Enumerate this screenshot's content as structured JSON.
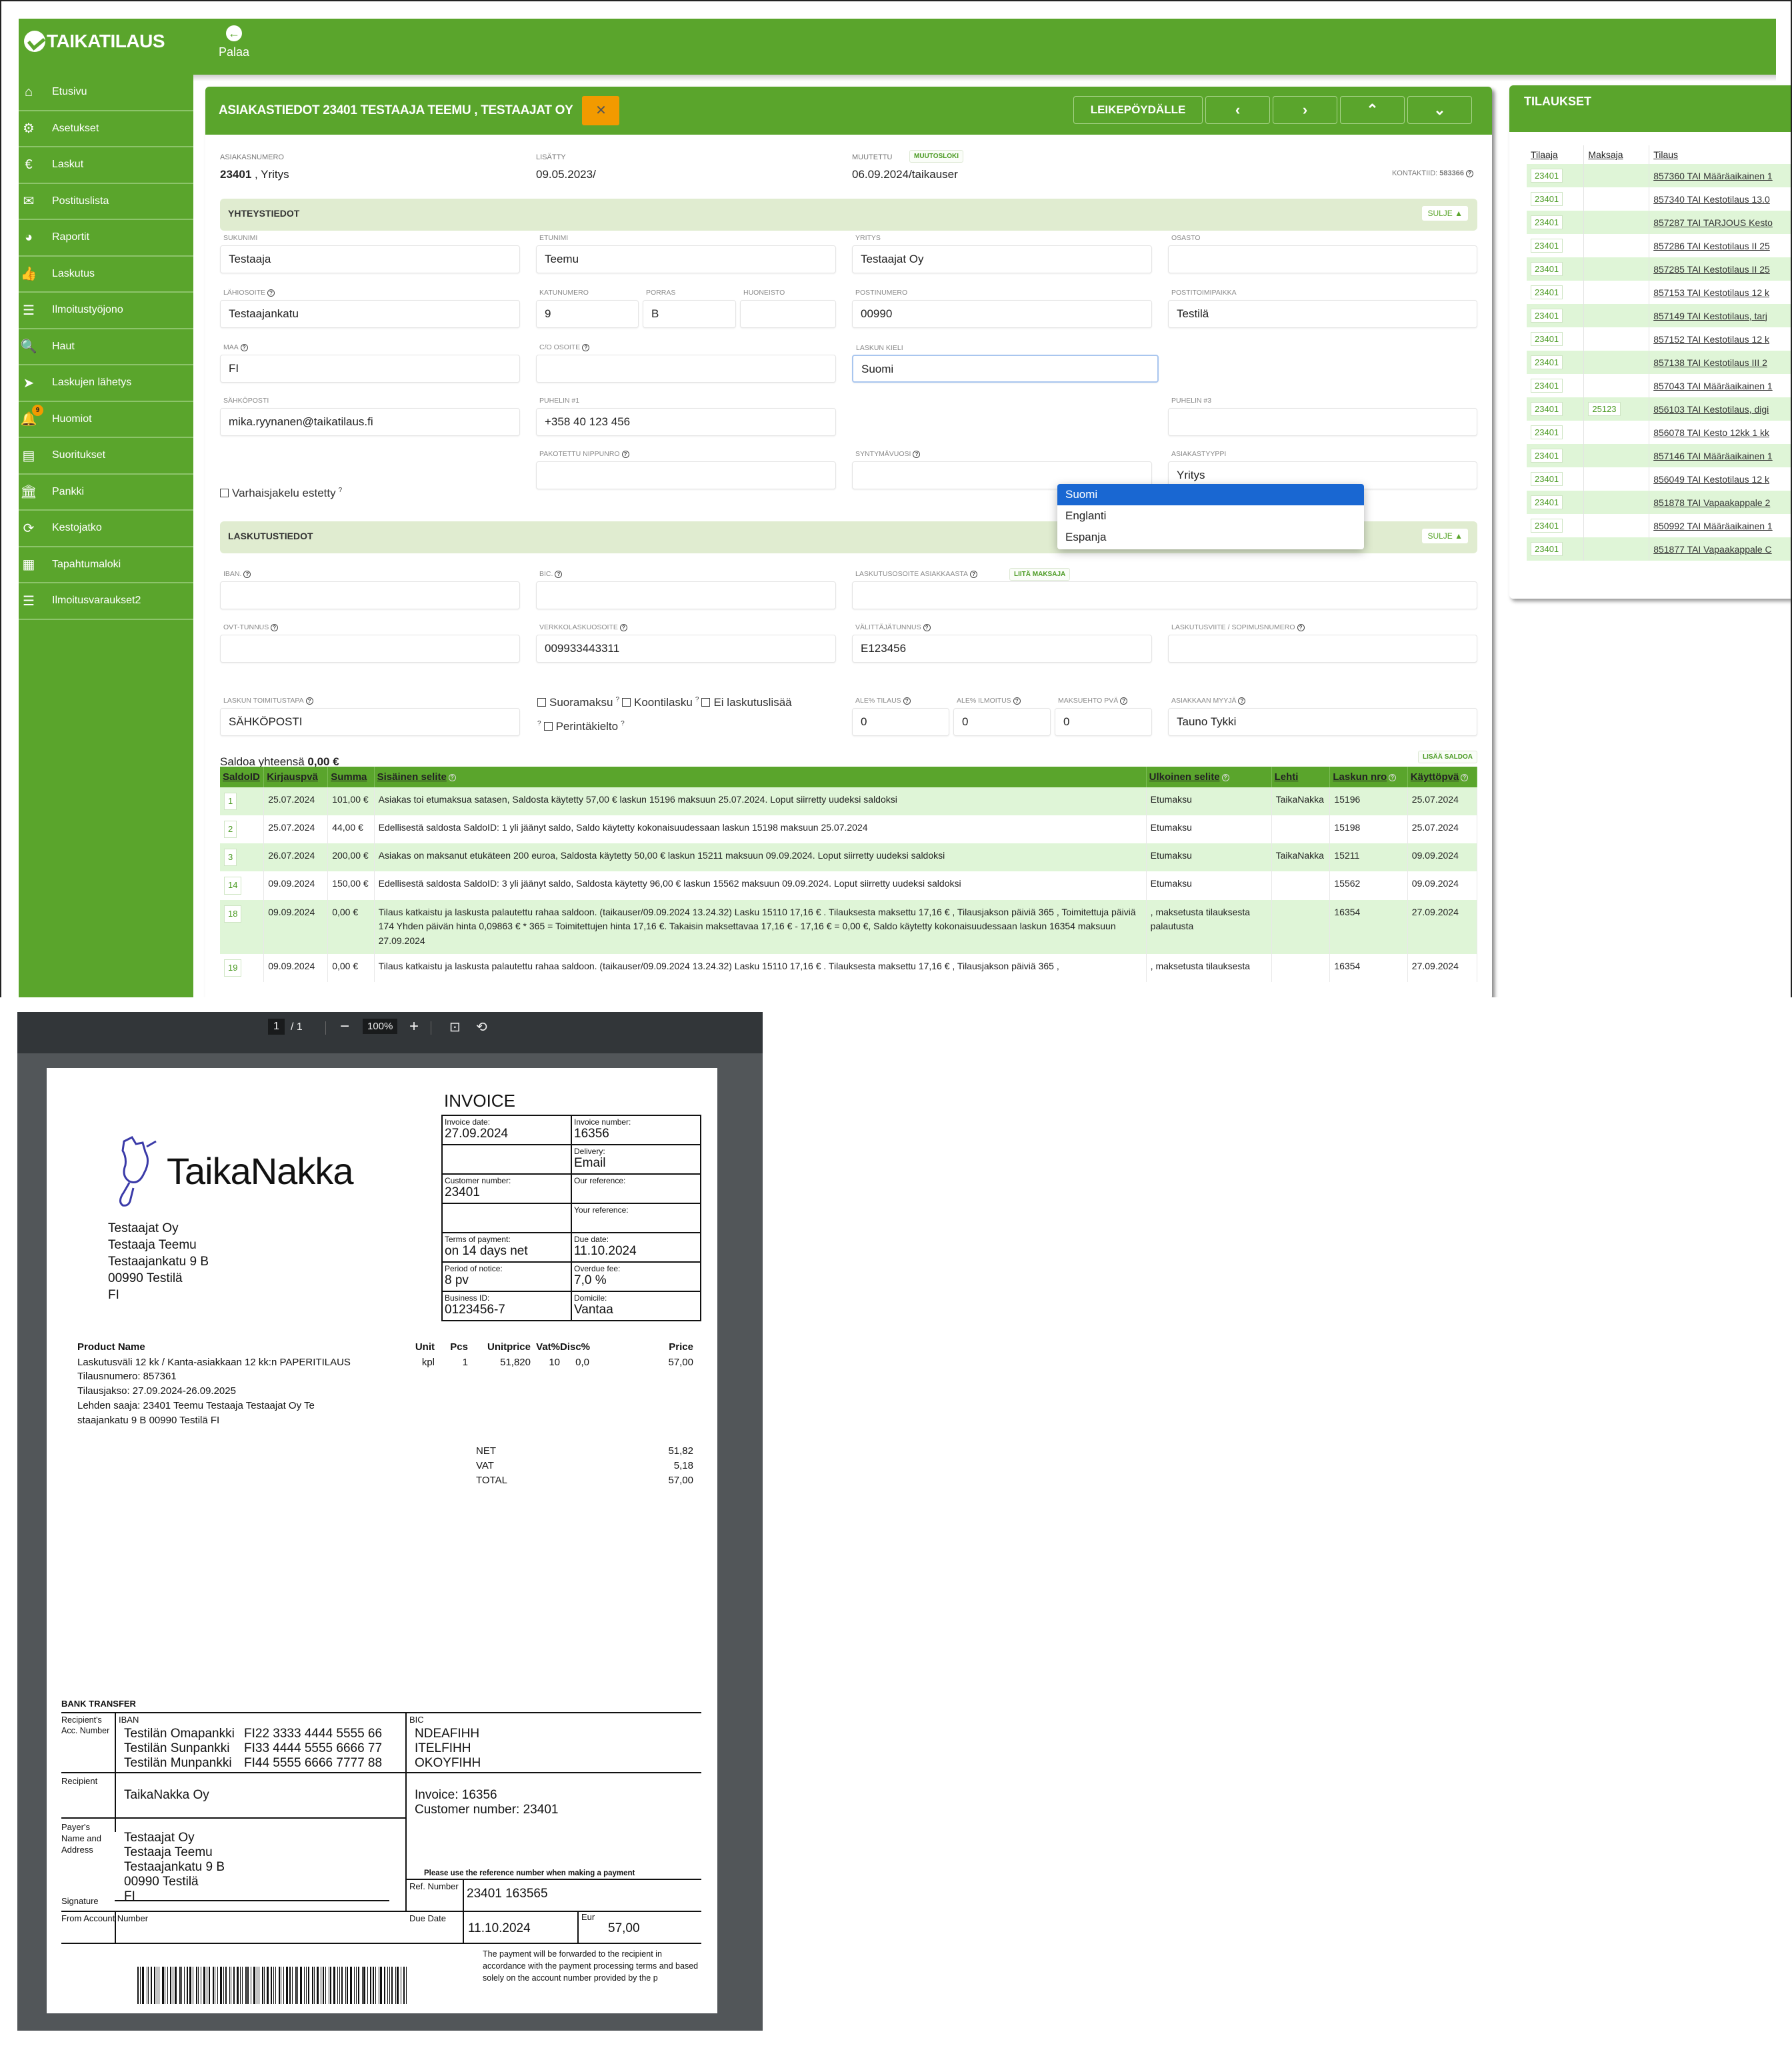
{
  "app": {
    "logo_text": "TAIKATILAUS",
    "back_label": "Palaa",
    "sidebar": [
      {
        "label": "Etusivu",
        "icon": "home-icon",
        "glyph": "⌂"
      },
      {
        "label": "Asetukset",
        "icon": "gear-icon",
        "glyph": "⚙"
      },
      {
        "label": "Laskut",
        "icon": "euro-icon",
        "glyph": "€"
      },
      {
        "label": "Postituslista",
        "icon": "envelope-icon",
        "glyph": "✉"
      },
      {
        "label": "Raportit",
        "icon": "pie-chart-icon",
        "glyph": "◕"
      },
      {
        "label": "Laskutus",
        "icon": "thumbs-up-icon",
        "glyph": "👍"
      },
      {
        "label": "Ilmoitustyöjono",
        "icon": "list-icon",
        "glyph": "☰"
      },
      {
        "label": "Haut",
        "icon": "search-plus-icon",
        "glyph": "🔍"
      },
      {
        "label": "Laskujen lähetys",
        "icon": "paper-plane-icon",
        "glyph": "➤"
      },
      {
        "label": "Huomiot",
        "icon": "bell-icon",
        "glyph": "🔔",
        "badge": "9"
      },
      {
        "label": "Suoritukset",
        "icon": "receipt-icon",
        "glyph": "▤"
      },
      {
        "label": "Pankki",
        "icon": "bank-icon",
        "glyph": "🏛"
      },
      {
        "label": "Kestojatko",
        "icon": "refresh-icon",
        "glyph": "⟳"
      },
      {
        "label": "Tapahtumaloki",
        "icon": "table-icon",
        "glyph": "▦"
      },
      {
        "label": "Ilmoitusvaraukset2",
        "icon": "indent-list-icon",
        "glyph": "☰"
      }
    ]
  },
  "customer": {
    "title": "ASIAKASTIEDOT 23401 TESTAAJA TEEMU , TESTAAJAT OY",
    "buttons": {
      "clipboard": "LEIKEPÖYDÄLLE",
      "prev": "‹",
      "next": "›",
      "up": "⌃",
      "down": "⌄"
    },
    "meta": {
      "asiakasnumero_label": "ASIAKASNUMERO",
      "asiakasnumero": "23401",
      "asiakastyyppi_suffix": " , Yritys",
      "lisatty_label": "LISÄTTY",
      "lisatty": "09.05.2023/",
      "muutettu_label": "MUUTETTU",
      "muutosloki": "MUUTOSLOKI",
      "muutettu": "06.09.2024/taikauser",
      "kontaktiid_label": "KONTAKTIID:",
      "kontaktiid": "583366"
    },
    "sections": {
      "contact": "YHTEYSTIEDOT",
      "billing": "LASKUTUSTIEDOT",
      "close": "SULJE ▲"
    },
    "fields": {
      "sukunimi": {
        "label": "SUKUNIMI",
        "value": "Testaaja"
      },
      "etunimi": {
        "label": "ETUNIMI",
        "value": "Teemu"
      },
      "yritys": {
        "label": "YRITYS",
        "value": "Testaajat Oy"
      },
      "osasto": {
        "label": "OSASTO",
        "value": ""
      },
      "lahiosoite": {
        "label": "LÄHIOSOITE",
        "value": "Testaajankatu"
      },
      "katunumero": {
        "label": "KATUNUMERO",
        "value": "9"
      },
      "porras": {
        "label": "PORRAS",
        "value": "B"
      },
      "huoneisto": {
        "label": "HUONEISTO",
        "value": ""
      },
      "postinumero": {
        "label": "POSTINUMERO",
        "value": "00990"
      },
      "postitoimipaikka": {
        "label": "POSTITOIMIPAIKKA",
        "value": "Testilä"
      },
      "maa": {
        "label": "MAA",
        "value": "FI"
      },
      "co_osoite": {
        "label": "C/O OSOITE",
        "value": ""
      },
      "laskun_kieli": {
        "label": "LASKUN KIELI",
        "value": "Suomi",
        "options": [
          "Suomi",
          "Englanti",
          "Espanja"
        ]
      },
      "sahkoposti": {
        "label": "SÄHKÖPOSTI",
        "value": "mika.ryynanen@taikatilaus.fi"
      },
      "puhelin1": {
        "label": "PUHELIN #1",
        "value": "+358 40 123 456"
      },
      "puhelin3": {
        "label": "PUHELIN #3",
        "value": ""
      },
      "varhaisjakelu": "Varhaisjakelu estetty",
      "pakotettu_nippunro": {
        "label": "PAKOTETTU NIPPUNRO",
        "value": ""
      },
      "syntymavuosi": {
        "label": "SYNTYMÄVUOSI",
        "value": ""
      },
      "asiakastyyppi": {
        "label": "ASIAKASTYYPPI",
        "value": "Yritys"
      },
      "iban": {
        "label": "IBAN.",
        "value": ""
      },
      "bic": {
        "label": "BIC.",
        "value": ""
      },
      "laskutusosoite": {
        "label": "LASKUTUSOSOITE ASIAKKAASTA",
        "value": "",
        "button": "LIITÄ MAKSAJA"
      },
      "ovt": {
        "label": "OVT-TUNNUS",
        "value": ""
      },
      "verkkolaskuosoite": {
        "label": "VERKKOLASKUOSOITE",
        "value": "009933443311"
      },
      "valittajatunnus": {
        "label": "VÄLITTÄJÄTUNNUS",
        "value": "E123456"
      },
      "laskutusviite": {
        "label": "LASKUTUSVIITE / SOPIMUSNUMERO",
        "value": ""
      },
      "toimitustapa": {
        "label": "LASKUN TOIMITUSTAPA",
        "value": "SÄHKÖPOSTI"
      },
      "checkboxes": [
        "Suoramaksu",
        "Koontilasku",
        "Ei laskutuslisää",
        "Perintäkielto"
      ],
      "ale_tilaus": {
        "label": "ALE% TILAUS",
        "value": "0"
      },
      "ale_ilmoitus": {
        "label": "ALE% ILMOITUS",
        "value": "0"
      },
      "maksuehto": {
        "label": "MAKSUEHTO PVÄ",
        "value": "0"
      },
      "myyja": {
        "label": "ASIAKKAAN MYYJÄ",
        "value": "Tauno Tykki"
      }
    },
    "saldo": {
      "total_label": "Saldoa yhteensä ",
      "total": "0,00 €",
      "add_button": "LISÄÄ SALDOA",
      "columns": [
        "SaldoID",
        "Kirjauspvä",
        "Summa",
        "Sisäinen selite",
        "Ulkoinen selite",
        "Lehti",
        "Laskun nro",
        "Käyttöpvä"
      ],
      "rows": [
        {
          "id": "1",
          "date": "25.07.2024",
          "sum": "101,00 €",
          "internal": "Asiakas toi etumaksua satasen, Saldosta käytetty 57,00 € laskun 15196 maksuun 25.07.2024. Loput siirretty uudeksi saldoksi",
          "external": "Etumaksu",
          "paper": "TaikaNakka",
          "invoice": "15196",
          "used": "25.07.2024"
        },
        {
          "id": "2",
          "date": "25.07.2024",
          "sum": "44,00 €",
          "internal": "Edellisestä saldosta SaldoID: 1 yli jäänyt saldo, Saldo käytetty kokonaisuudessaan laskun 15198 maksuun 25.07.2024",
          "external": "Etumaksu",
          "paper": "",
          "invoice": "15198",
          "used": "25.07.2024"
        },
        {
          "id": "3",
          "date": "26.07.2024",
          "sum": "200,00 €",
          "internal": "Asiakas on maksanut etukäteen 200 euroa, Saldosta käytetty 50,00 € laskun 15211 maksuun 09.09.2024. Loput siirretty uudeksi saldoksi",
          "external": "Etumaksu",
          "paper": "TaikaNakka",
          "invoice": "15211",
          "used": "09.09.2024"
        },
        {
          "id": "14",
          "date": "09.09.2024",
          "sum": "150,00 €",
          "internal": "Edellisestä saldosta SaldoID: 3 yli jäänyt saldo, Saldosta käytetty 96,00 € laskun 15562 maksuun 09.09.2024. Loput siirretty uudeksi saldoksi",
          "external": "Etumaksu",
          "paper": "",
          "invoice": "15562",
          "used": "09.09.2024"
        },
        {
          "id": "18",
          "date": "09.09.2024",
          "sum": "0,00 €",
          "internal": "Tilaus katkaistu ja laskusta palautettu rahaa saldoon. (taikauser/09.09.2024 13.24.32) Lasku 15110 17,16 € . Tilauksesta maksettu 17,16 € , Tilausjakson päiviä 365 , Toimitettuja päiviä 174 Yhden päivän hinta 0,09863 € * 365 = Toimitettujen hinta 17,16 €. Takaisin maksettavaa 17,16 € - 17,16 € = 0,00 €, Saldo käytetty kokonaisuudessaan laskun 16354 maksuun 27.09.2024",
          "external": ", maksetusta tilauksesta palautusta",
          "paper": "",
          "invoice": "16354",
          "used": "27.09.2024"
        },
        {
          "id": "19",
          "date": "09.09.2024",
          "sum": "0,00 €",
          "internal": "Tilaus katkaistu ja laskusta palautettu rahaa saldoon. (taikauser/09.09.2024 13.24.32) Lasku 15110 17,16 € . Tilauksesta maksettu 17,16 € , Tilausjakson päiviä 365 ,",
          "external": ", maksetusta tilauksesta",
          "paper": "",
          "invoice": "16354",
          "used": "27.09.2024"
        }
      ]
    }
  },
  "orders": {
    "title": "TILAUKSET",
    "columns": [
      "Tilaaja",
      "Maksaja",
      "Tilaus"
    ],
    "rows": [
      {
        "orderer": "23401",
        "payer": "",
        "order": "857360 TAI Määräaikainen 1"
      },
      {
        "orderer": "23401",
        "payer": "",
        "order": "857340 TAI Kestotilaus 13.0"
      },
      {
        "orderer": "23401",
        "payer": "",
        "order": "857287 TAI TARJOUS Kesto"
      },
      {
        "orderer": "23401",
        "payer": "",
        "order": "857286 TAI Kestotilaus II 25"
      },
      {
        "orderer": "23401",
        "payer": "",
        "order": "857285 TAI Kestotilaus II 25"
      },
      {
        "orderer": "23401",
        "payer": "",
        "order": "857153 TAI Kestotilaus 12 k"
      },
      {
        "orderer": "23401",
        "payer": "",
        "order": "857149 TAI Kestotilaus, tarj"
      },
      {
        "orderer": "23401",
        "payer": "",
        "order": "857152 TAI Kestotilaus 12 k"
      },
      {
        "orderer": "23401",
        "payer": "",
        "order": "857138 TAI Kestotilaus III 2"
      },
      {
        "orderer": "23401",
        "payer": "",
        "order": "857043 TAI Määräaikainen 1"
      },
      {
        "orderer": "23401",
        "payer": "25123",
        "order": "856103 TAI Kestotilaus, digi"
      },
      {
        "orderer": "23401",
        "payer": "",
        "order": "856078 TAI Kesto 12kk 1 kk"
      },
      {
        "orderer": "23401",
        "payer": "",
        "order": "857146 TAI Määräaikainen 1"
      },
      {
        "orderer": "23401",
        "payer": "",
        "order": "856049 TAI Kestotilaus 12 k"
      },
      {
        "orderer": "23401",
        "payer": "",
        "order": "851878 TAI Vapaakappale 2"
      },
      {
        "orderer": "23401",
        "payer": "",
        "order": "850992 TAI Määräaikainen 1"
      },
      {
        "orderer": "23401",
        "payer": "",
        "order": "851877 TAI Vapaakappale C"
      }
    ]
  },
  "pdf_viewer": {
    "page_current": "1",
    "page_total": "/ 1",
    "zoom": "100%",
    "zoom_out": "−",
    "zoom_in": "+"
  },
  "invoice": {
    "title": "INVOICE",
    "brand": "TaikaNakka",
    "grid": [
      [
        {
          "k": "Invoice date:",
          "v": "27.09.2024"
        },
        {
          "k": "Invoice number:",
          "v": "16356"
        }
      ],
      [
        {
          "k": "",
          "v": ""
        },
        {
          "k": "Delivery:",
          "v": "Email"
        }
      ],
      [
        {
          "k": "Customer number:",
          "v": "23401"
        },
        {
          "k": "Our reference:",
          "v": ""
        }
      ],
      [
        {
          "k": "",
          "v": ""
        },
        {
          "k": "Your reference:",
          "v": ""
        }
      ],
      [
        {
          "k": "Terms of payment:",
          "v": "on 14 days net"
        },
        {
          "k": "Due date:",
          "v": "11.10.2024"
        }
      ],
      [
        {
          "k": "Period of notice:",
          "v": "8 pv"
        },
        {
          "k": "Overdue fee:",
          "v": "7,0 %"
        }
      ],
      [
        {
          "k": "Business ID:",
          "v": "0123456-7"
        },
        {
          "k": "Domicile:",
          "v": "Vantaa"
        }
      ]
    ],
    "address": [
      "Testaajat Oy",
      "Testaaja Teemu",
      "Testaajankatu 9 B",
      "00990 Testilä",
      "FI"
    ],
    "product_header": [
      "Product Name",
      "Unit",
      "Pcs",
      "Unitprice",
      "Vat%",
      "Disc%",
      "Price"
    ],
    "product_row": [
      "Laskutusväli 12 kk / Kanta-asiakkaan 12 kk:n PAPERITILAUS",
      "kpl",
      "1",
      "51,820",
      "10",
      "0,0",
      "57,00"
    ],
    "product_details": [
      "Tilausnumero: 857361",
      "Tilausjakso: 27.09.2024-26.09.2025",
      "Lehden saaja: 23401 Teemu Testaaja Testaajat Oy Te",
      "staajankatu 9 B 00990 Testilä FI"
    ],
    "totals": [
      {
        "k": "NET",
        "v": "51,82"
      },
      {
        "k": "VAT",
        "v": "5,18"
      },
      {
        "k": "TOTAL",
        "v": "57,00"
      }
    ],
    "bank": {
      "title": "BANK TRANSFER",
      "recipient_acc_label": "Recipient's Acc. Number",
      "iban_label": "IBAN",
      "bic_label": "BIC",
      "accounts": [
        {
          "bank": "Testilän Omapankki",
          "iban": "FI22 3333 4444 5555 66",
          "bic": "NDEAFIHH"
        },
        {
          "bank": "Testilän Sunpankki",
          "iban": "FI33 4444 5555 6666 77",
          "bic": "ITELFIHH"
        },
        {
          "bank": "Testilän Munpankki",
          "iban": "FI44 5555 6666 7777 88",
          "bic": "OKOYFIHH"
        }
      ],
      "recipient_label": "Recipient",
      "recipient": "TaikaNakka Oy",
      "invoice_ref": "Invoice: 16356",
      "customer_ref": "Customer number: 23401",
      "payer_label": "Payer's Name and Address",
      "payer": [
        "Testaajat Oy",
        "Testaaja Teemu",
        "Testaajankatu 9 B",
        "00990 Testilä",
        "FI"
      ],
      "signature_label": "Signature",
      "ref_note": "Please use the reference number when making a payment",
      "ref_label": "Ref. Number",
      "ref_number": "23401 163565",
      "from_account_label": "From Account Number",
      "due_label": "Due Date",
      "due_date": "11.10.2024",
      "eur_label": "Eur",
      "amount": "57,00",
      "disclaimer": "The payment will be forwarded to the recipient in accordance with the payment processing terms and based solely on the account number provided by the p"
    }
  }
}
